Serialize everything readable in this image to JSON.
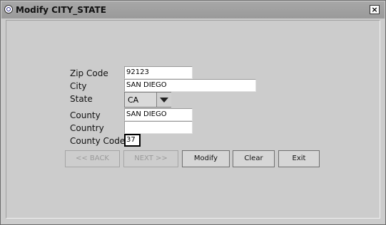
{
  "window": {
    "title": "Modify CITY_STATE",
    "close_label": "×"
  },
  "form": {
    "zip": {
      "label": "Zip Code",
      "value": "92123"
    },
    "city": {
      "label": "City",
      "value": "SAN DIEGO"
    },
    "state": {
      "label": "State",
      "value": "CA"
    },
    "county": {
      "label": "County",
      "value": "SAN DIEGO"
    },
    "country": {
      "label": "Country",
      "value": ""
    },
    "county_code": {
      "label": "County Code",
      "value": "37"
    }
  },
  "buttons": {
    "back": "<< BACK",
    "next": "NEXT >>",
    "modify": "Modify",
    "clear": "Clear",
    "exit": "Exit"
  }
}
